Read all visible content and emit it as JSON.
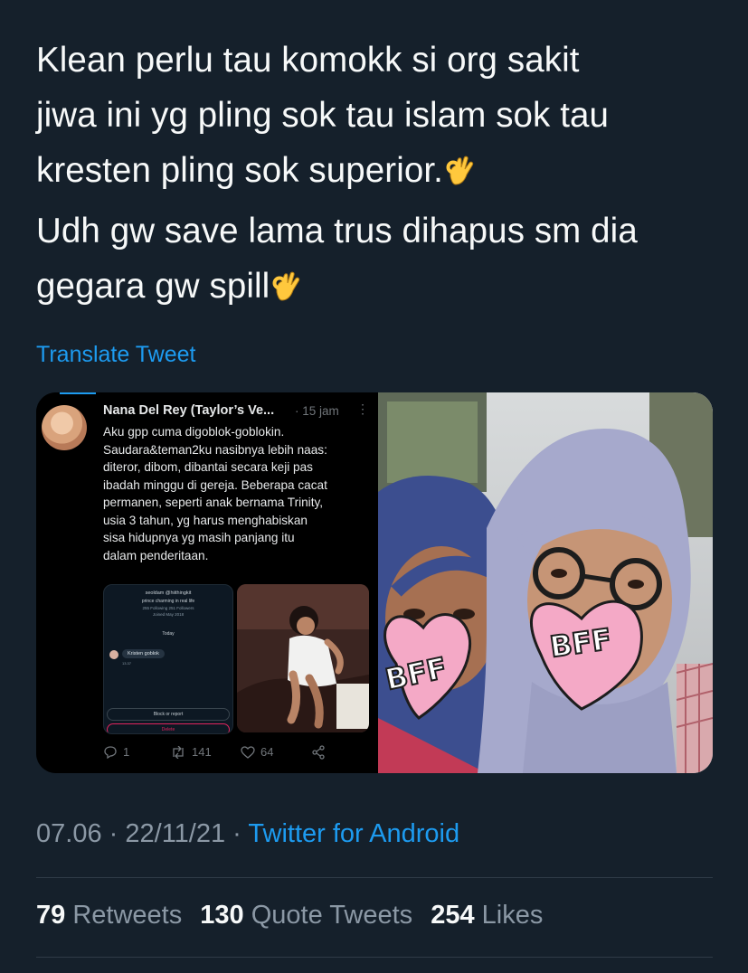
{
  "tweet": {
    "lines": [
      "Klean perlu tau komokk si org sakit",
      "jiwa ini yg pling sok tau islam sok tau",
      "kresten pling sok superior.",
      "Udh gw save lama trus dihapus sm dia",
      "gegara gw spill"
    ],
    "emoji": "ok-hand-emoji",
    "translate_label": "Translate Tweet"
  },
  "embedded_tweet": {
    "author": "Nana Del Rey (Taylor’s Ve...",
    "time": "· 15 jam",
    "lines": [
      "Aku gpp cuma digoblok-goblokin.",
      "Saudara&teman2ku nasibnya lebih naas:",
      "diteror, dibom, dibantai secara keji pas",
      "ibadah minggu di gereja. Beberapa cacat",
      "permanen, seperti anak bernama Trinity,",
      "usia 3 tahun, yg harus menghabiskan",
      "sisa hidupnya yg masih panjang itu",
      "dalam penderitaan."
    ],
    "dm": {
      "name": "seoldam @hiithingkit",
      "bio": "prince charming in real life",
      "stats": "255 Following 251 Followers",
      "joined": "Joined May 2018",
      "today": "Today",
      "message": "Kristen goblok",
      "message_time": "13.37",
      "block_label": "Block or report",
      "delete_label": "Delete"
    },
    "replies": "1",
    "retweets": "141",
    "likes": "64"
  },
  "photo": {
    "sticker_text_left": "BFF",
    "sticker_text_right": "BFF"
  },
  "meta": {
    "time": "07.06",
    "date": "22/11/21",
    "separator": "·",
    "source": "Twitter for Android"
  },
  "stats": {
    "retweets_count": "79",
    "retweets_label": "Retweets",
    "quotes_count": "130",
    "quotes_label": "Quote Tweets",
    "likes_count": "254",
    "likes_label": "Likes"
  },
  "colors": {
    "background": "#15202b",
    "accent": "#1d9bf0",
    "text": "#f7f9f9",
    "muted": "#8b98a5"
  }
}
